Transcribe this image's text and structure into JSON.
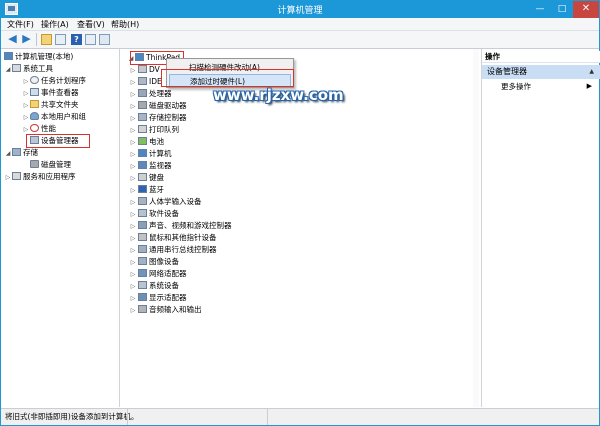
{
  "window": {
    "title": "计算机管理",
    "min": "—",
    "max": "□",
    "close": "✕"
  },
  "menu": [
    "文件(F)",
    "操作(A)",
    "查看(V)",
    "帮助(H)"
  ],
  "toolbar": {
    "back": "◀",
    "forward": "▶",
    "help": "?"
  },
  "left_tree": {
    "root": "计算机管理(本地)",
    "system_tools": "系统工具",
    "task_scheduler": "任务计划程序",
    "event_viewer": "事件查看器",
    "shared_folders": "共享文件夹",
    "local_users": "本地用户和组",
    "performance": "性能",
    "device_manager": "设备管理器",
    "storage": "存储",
    "disk_management": "磁盘管理",
    "services": "服务和应用程序"
  },
  "devices": {
    "root": "ThinkPad",
    "items": [
      "DV",
      "IDE",
      "处理器",
      "磁盘驱动器",
      "存储控制器",
      "打印队列",
      "电池",
      "计算机",
      "监视器",
      "键盘",
      "蓝牙",
      "人体学输入设备",
      "软件设备",
      "声音、视频和游戏控制器",
      "鼠标和其他指针设备",
      "通用串行总线控制器",
      "图像设备",
      "网络适配器",
      "系统设备",
      "显示适配器",
      "音频输入和输出"
    ]
  },
  "context_menu": {
    "scan": "扫描检测硬件改动(A)",
    "add_legacy": "添加过时硬件(L)"
  },
  "watermark": "www.rjzxw.com",
  "actions": {
    "header": "操作",
    "selected": "设备管理器",
    "more": "更多操作"
  },
  "status": "将旧式(非即插即用)设备添加到计算机。",
  "colors": {
    "titlebar": "#1c97d8",
    "highlight": "#d9322b",
    "selection": "#c9def5"
  }
}
